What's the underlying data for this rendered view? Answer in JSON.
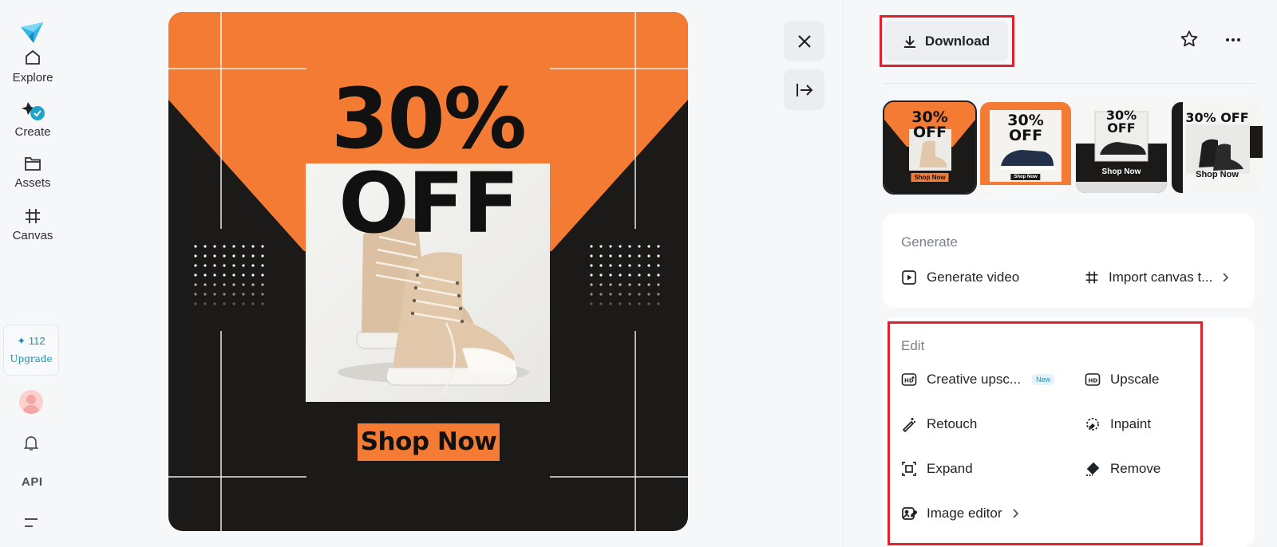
{
  "sidebar": {
    "items": [
      {
        "label": "Explore",
        "icon": "home-icon"
      },
      {
        "label": "Create",
        "icon": "create-icon"
      },
      {
        "label": "Assets",
        "icon": "folder-icon"
      },
      {
        "label": "Canvas",
        "icon": "canvas-icon"
      }
    ],
    "credits": {
      "count": "✦ 112",
      "upgrade": "Upgrade"
    },
    "api_label": "API"
  },
  "poster": {
    "headline_1": "30%",
    "headline_2": "OFF",
    "cta": "Shop Now",
    "colors": {
      "orange": "#f47b34",
      "dark": "#1b1a19"
    }
  },
  "controls": {
    "close_icon": "close-icon",
    "collapse_icon": "arrow-to-right-icon"
  },
  "panel": {
    "download_label": "Download",
    "thumbnails": [
      {
        "headline": "30%\nOFF",
        "cta": "Shop Now",
        "selected": true
      },
      {
        "headline": "30%\nOFF",
        "cta": "Shop Now",
        "selected": false
      },
      {
        "headline": "30%\nOFF",
        "cta": "Shop Now",
        "selected": false
      },
      {
        "headline": "30% OFF",
        "cta": "Shop Now",
        "selected": false
      }
    ],
    "generate": {
      "title": "Generate",
      "actions": [
        {
          "label": "Generate video",
          "icon": "play-square-icon"
        },
        {
          "label": "Import canvas t...",
          "icon": "canvas-icon",
          "has_chevron": true
        }
      ]
    },
    "edit": {
      "title": "Edit",
      "actions": [
        {
          "label": "Creative upsc...",
          "icon": "hd-plus-icon",
          "badge": "New"
        },
        {
          "label": "Upscale",
          "icon": "hd-icon"
        },
        {
          "label": "Retouch",
          "icon": "magic-wand-icon"
        },
        {
          "label": "Inpaint",
          "icon": "inpaint-icon"
        },
        {
          "label": "Expand",
          "icon": "expand-icon"
        },
        {
          "label": "Remove",
          "icon": "eraser-icon"
        },
        {
          "label": "Image editor",
          "icon": "image-edit-icon",
          "has_chevron": true
        }
      ]
    }
  }
}
